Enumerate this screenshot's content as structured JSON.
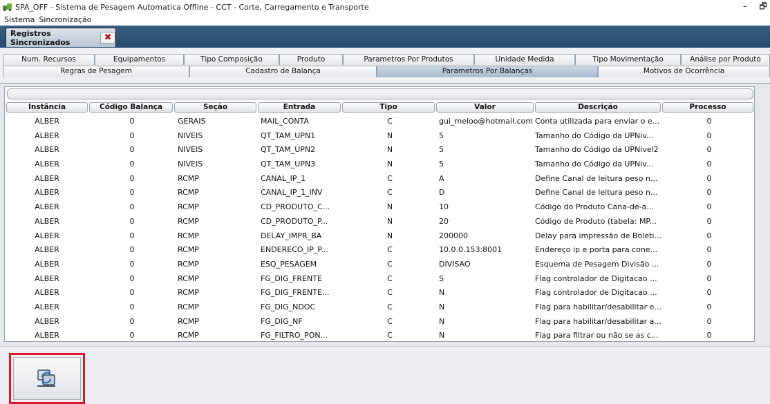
{
  "window": {
    "title": "SPA_OFF - Sistema de Pesagem Automatica Offline - CCT - Corte, Carregamento e Transporte",
    "minimize_glyph": "–",
    "restore_glyph": "🗗"
  },
  "menu": {
    "items": [
      "Sistema",
      "Sincronização"
    ]
  },
  "doc_tab": {
    "label": "Registros Sincronizados",
    "close_glyph": "✖"
  },
  "tabs": {
    "row1": [
      "Num. Recursos",
      "Equipamentos",
      "Tipo Composição",
      "Produto",
      "Parametros Por Produtos",
      "Unidade Medida",
      "Tipo Movimentação",
      "Análise por Produto"
    ],
    "row2": [
      "Regras de Pesagem",
      "Cadastro de Balança",
      "Parametros Por Balanças",
      "Motivos de Ocorrência"
    ],
    "selected": "Parametros Por Balanças"
  },
  "table": {
    "headers": [
      "Instância",
      "Código Balança",
      "Seção",
      "Entrada",
      "Tipo",
      "Valor",
      "Descrição",
      "Processo"
    ],
    "rows": [
      [
        "ALBER",
        "0",
        "GERAIS",
        "MAIL_CONTA",
        "C",
        "gui_meloo@hotmail.com",
        "Conta utilizada para enviar o e...",
        "0"
      ],
      [
        "ALBER",
        "0",
        "NIVEIS",
        "QT_TAM_UPN1",
        "N",
        "5",
        "Tamanho do Código da UPNiv...",
        "0"
      ],
      [
        "ALBER",
        "0",
        "NIVEIS",
        "QT_TAM_UPN2",
        "N",
        "5",
        "Tamanho do Código da UPNivel2",
        "0"
      ],
      [
        "ALBER",
        "0",
        "NIVEIS",
        "QT_TAM_UPN3",
        "N",
        "5",
        "Tamanho do Código da UPNiv...",
        "0"
      ],
      [
        "ALBER",
        "0",
        "RCMP",
        "CANAL_IP_1",
        "C",
        "A",
        "Define Canal de leitura peso n...",
        "0"
      ],
      [
        "ALBER",
        "0",
        "RCMP",
        "CANAL_IP_1_INV",
        "C",
        "D",
        "Define Canal de leitura peso n...",
        "0"
      ],
      [
        "ALBER",
        "0",
        "RCMP",
        "CD_PRODUTO_C...",
        "N",
        "10",
        "Código do Produto Cana-de-a...",
        "0"
      ],
      [
        "ALBER",
        "0",
        "RCMP",
        "CD_PRODUTO_P...",
        "N",
        "20",
        "Código de Produto (tabela: MP...",
        "0"
      ],
      [
        "ALBER",
        "0",
        "RCMP",
        "DELAY_IMPR_BA",
        "N",
        "200000",
        "Delay para impressão de Boleti...",
        "0"
      ],
      [
        "ALBER",
        "0",
        "RCMP",
        "ENDERECO_IP_P...",
        "C",
        "10.0.0.153:8001",
        "Endereço ip e porta para cone...",
        "0"
      ],
      [
        "ALBER",
        "0",
        "RCMP",
        "ESQ_PESAGEM",
        "C",
        "DIVISAO",
        "Esquema de Pesagem Divisão ...",
        "0"
      ],
      [
        "ALBER",
        "0",
        "RCMP",
        "FG_DIG_FRENTE",
        "C",
        "S",
        "Flag controlador de Digitacao ...",
        "0"
      ],
      [
        "ALBER",
        "0",
        "RCMP",
        "FG_DIG_FRENTE...",
        "C",
        "N",
        "Flag controlador de Digitacao ...",
        "0"
      ],
      [
        "ALBER",
        "0",
        "RCMP",
        "FG_DIG_NDOC",
        "C",
        "N",
        "Flag para habilitar/desabilitar e...",
        "0"
      ],
      [
        "ALBER",
        "0",
        "RCMP",
        "FG_DIG_NF",
        "C",
        "N",
        "Flag para habilitar/desabilitar a...",
        "0"
      ],
      [
        "ALBER",
        "0",
        "RCMP",
        "FG_FILTRO_PON...",
        "C",
        "N",
        "Flag para filtrar ou não se as c...",
        "0"
      ]
    ]
  },
  "bottom": {
    "sync_button_icon": "sync-icon"
  },
  "colors": {
    "title_bar": "#2f5576",
    "highlight": "#e0182a",
    "selected_tab": "#b9c9da"
  }
}
